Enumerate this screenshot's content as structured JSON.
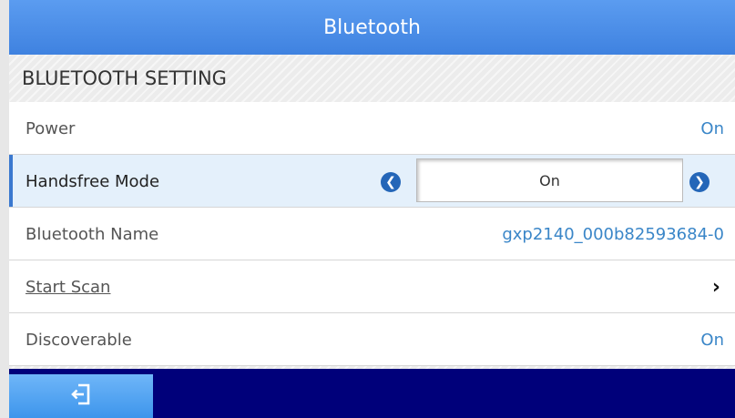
{
  "window": {
    "title": "Bluetooth"
  },
  "section": {
    "title": "BLUETOOTH SETTING"
  },
  "rows": {
    "power": {
      "label": "Power",
      "value": "On"
    },
    "handsfree": {
      "label": "Handsfree Mode",
      "value": "On",
      "prev_icon": "chevron-left-icon",
      "next_icon": "chevron-right-icon"
    },
    "name": {
      "label": "Bluetooth Name",
      "value": "gxp2140_000b82593684-0"
    },
    "scan": {
      "label": "Start Scan",
      "icon": "chevron-right-icon"
    },
    "discoverable": {
      "label": "Discoverable",
      "value": "On"
    }
  },
  "footer": {
    "exit_icon": "exit-icon"
  },
  "colors": {
    "title_bar": "#4a8fe8",
    "accent_value": "#3a86c8",
    "selection_bar": "#3a78cf",
    "bottom_bar": "#00007a"
  }
}
